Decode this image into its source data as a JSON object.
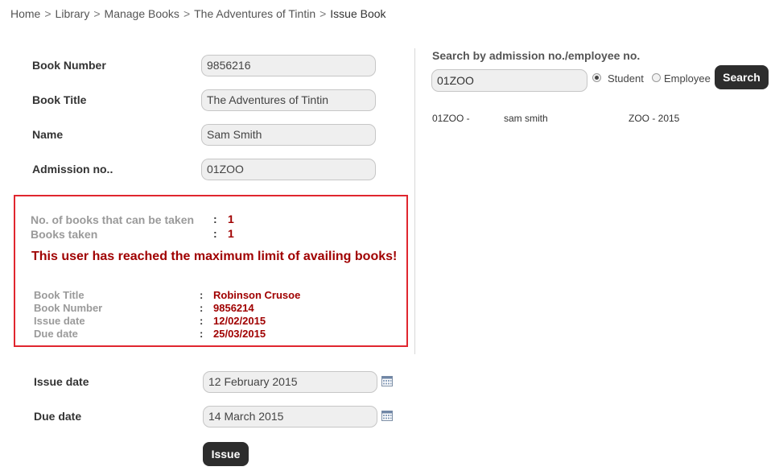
{
  "breadcrumb": {
    "items": [
      "Home",
      "Library",
      "Manage Books",
      "The Adventures of Tintin"
    ],
    "current": "Issue Book",
    "separator": ">"
  },
  "form": {
    "book_number": {
      "label": "Book Number",
      "value": "9856216"
    },
    "book_title": {
      "label": "Book Title",
      "value": "The Adventures of Tintin"
    },
    "name": {
      "label": "Name",
      "value": "Sam Smith"
    },
    "admission_no": {
      "label": "Admission no..",
      "value": "01ZOO"
    },
    "issue_date": {
      "label": "Issue date",
      "value": "12 February 2015"
    },
    "due_date": {
      "label": "Due date",
      "value": "14 March 2015"
    },
    "issue_button": "Issue"
  },
  "alert": {
    "books_can_take_label": "No. of books that can be taken",
    "books_can_take_value": "1",
    "books_taken_label": "Books taken",
    "books_taken_value": "1",
    "colon": ":",
    "message": "This user has reached the maximum limit of availing books!",
    "current_book": {
      "title_label": "Book Title",
      "title_value": "Robinson Crusoe",
      "number_label": "Book Number",
      "number_value": "9856214",
      "issue_label": "Issue date",
      "issue_value": "12/02/2015",
      "due_label": "Due date",
      "due_value": "25/03/2015"
    },
    "border_color": "#e0262f",
    "value_color": "#a00000"
  },
  "search": {
    "heading": "Search by admission no./employee no.",
    "value": "01ZOO",
    "options": [
      {
        "label": "Student",
        "checked": true
      },
      {
        "label": "Employee",
        "checked": false
      }
    ],
    "button": "Search",
    "results": [
      {
        "id": "01ZOO -",
        "name": "sam smith",
        "class": "ZOO - 2015"
      }
    ]
  },
  "icons": {
    "calendar": "calendar-icon"
  }
}
